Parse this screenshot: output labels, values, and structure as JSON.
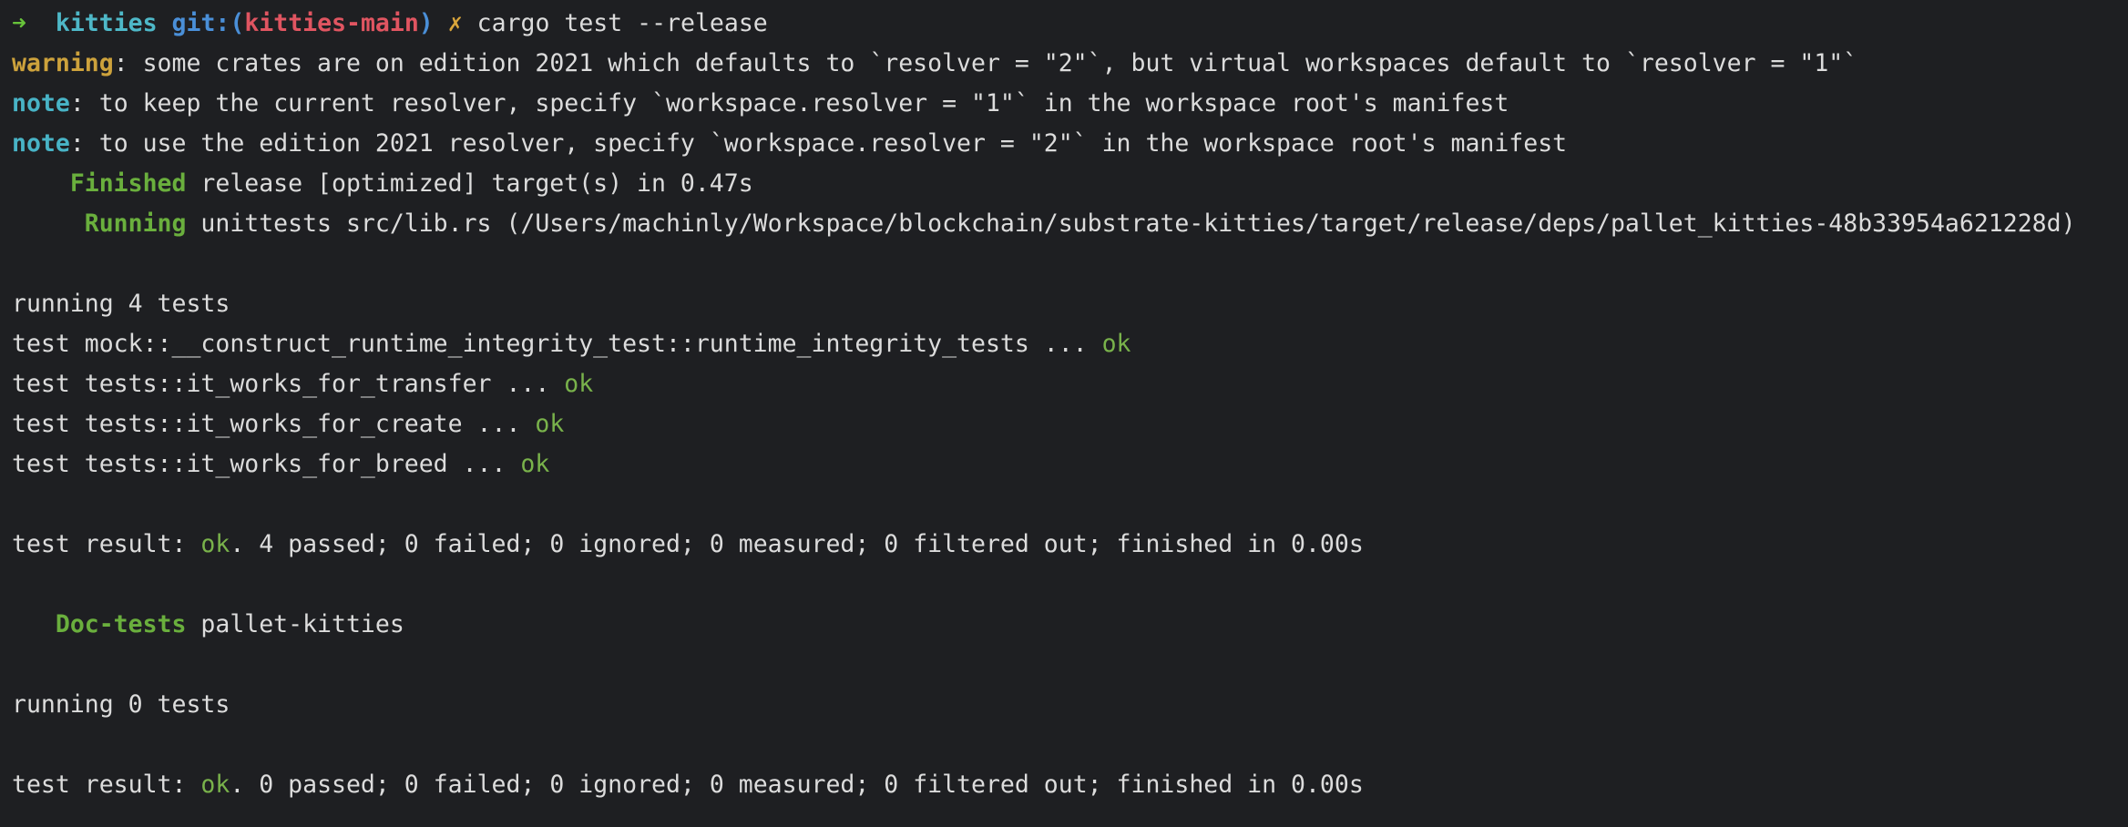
{
  "prompt": {
    "arrow": "➜",
    "dir": "kitties",
    "git_prefix": "git:(",
    "branch": "kitties-main",
    "git_suffix": ")",
    "dirty_mark": "✗",
    "command": "cargo test --release"
  },
  "warning_line": {
    "label": "warning",
    "text": ": some crates are on edition 2021 which defaults to `resolver = \"2\"`, but virtual workspaces default to `resolver = \"1\"`"
  },
  "note_lines": [
    {
      "label": "note",
      "text": ": to keep the current resolver, specify `workspace.resolver = \"1\"` in the workspace root's manifest"
    },
    {
      "label": "note",
      "text": ": to use the edition 2021 resolver, specify `workspace.resolver = \"2\"` in the workspace root's manifest"
    }
  ],
  "finished_line": {
    "label": "    Finished",
    "text": " release [optimized] target(s) in 0.47s"
  },
  "running_line": {
    "label": "     Running",
    "text": " unittests src/lib.rs (/Users/machinly/Workspace/blockchain/substrate-kitties/target/release/deps/pallet_kitties-48b33954a621228d)"
  },
  "unit_tests": {
    "header": "running 4 tests",
    "tests": [
      {
        "name": "test mock::__construct_runtime_integrity_test::runtime_integrity_tests ... ",
        "result": "ok"
      },
      {
        "name": "test tests::it_works_for_transfer ... ",
        "result": "ok"
      },
      {
        "name": "test tests::it_works_for_create ... ",
        "result": "ok"
      },
      {
        "name": "test tests::it_works_for_breed ... ",
        "result": "ok"
      }
    ],
    "result_prefix": "test result: ",
    "result_status": "ok",
    "result_summary": ". 4 passed; 0 failed; 0 ignored; 0 measured; 0 filtered out; finished in 0.00s"
  },
  "doc_tests_line": {
    "label": "   Doc-tests",
    "text": " pallet-kitties"
  },
  "doc_tests": {
    "header": "running 0 tests",
    "result_prefix": "test result: ",
    "result_status": "ok",
    "result_summary": ". 0 passed; 0 failed; 0 ignored; 0 measured; 0 filtered out; finished in 0.00s"
  },
  "colors": {
    "background": "#1e1f22",
    "text": "#dcdcdc",
    "prompt_arrow": "#67c23a",
    "prompt_dir": "#4eb8c8",
    "prompt_git": "#4a8fd8",
    "prompt_branch": "#e05561",
    "prompt_dirty": "#d9a53b",
    "warning": "#cda23c",
    "note": "#48b3c6",
    "cargo_status": "#6aaf3d",
    "ok": "#79b24b"
  }
}
